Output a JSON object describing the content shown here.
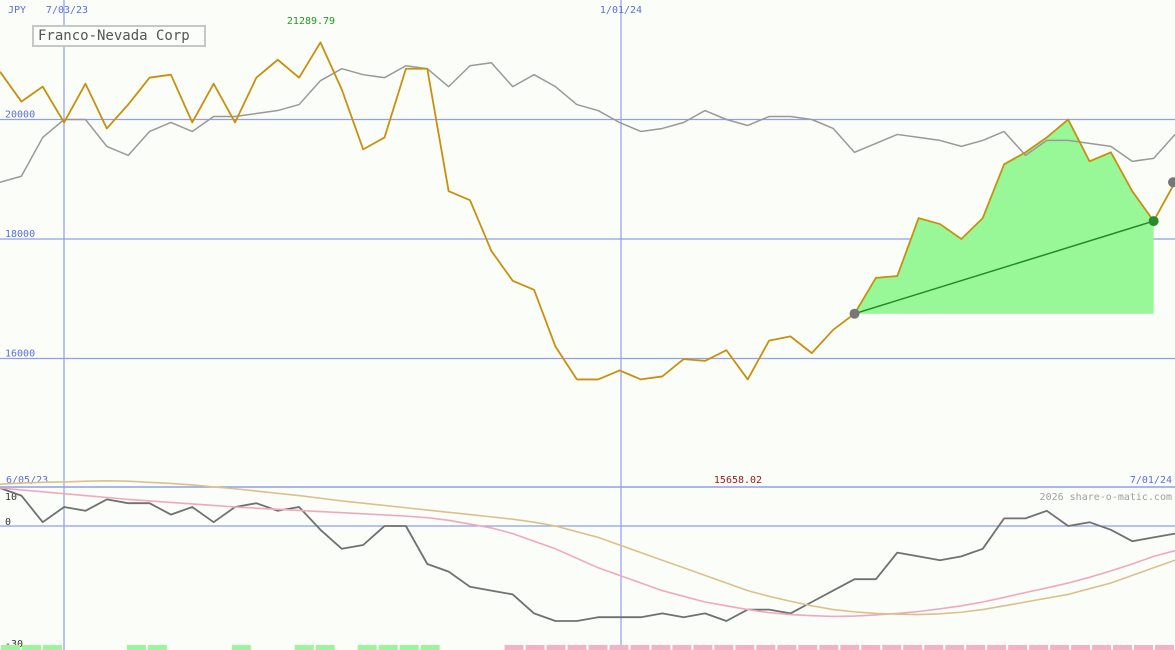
{
  "chart_data": [
    {
      "type": "line",
      "title": "Franco-Nevada Corp",
      "currency_label": "JPY",
      "x": [
        "7/03/23",
        "1/01/24"
      ],
      "ylabel": "",
      "xlabel": "",
      "ylim": [
        14000,
        22000
      ],
      "y_ticks": [
        "20000",
        "18000",
        "16000"
      ],
      "x_ticks": [
        "7/03/23",
        "1/01/24"
      ],
      "high_label": "21289.79",
      "series": [
        {
          "values": [
            20800,
            20300,
            20550,
            19950,
            20600,
            19850,
            20250,
            20700,
            20750,
            19950,
            20600,
            19950,
            20700,
            21000,
            20700,
            21290,
            20500,
            19500,
            19700,
            20850,
            20850,
            18800,
            18650,
            17800,
            17300,
            17150,
            16200,
            15650,
            15650,
            15800,
            15650,
            15700,
            15990,
            15960,
            16140,
            15650,
            16300,
            16370,
            16090,
            16480,
            16750,
            17350,
            17380,
            18350,
            18250,
            18000,
            18350,
            19250,
            19450,
            19700,
            20000,
            19300,
            19450,
            18800,
            18300,
            18950
          ],
          "color": "#c8900f"
        },
        {
          "values": [
            18950,
            19050,
            19700,
            20000,
            20000,
            19550,
            19400,
            19800,
            19950,
            19800,
            20050,
            20050,
            20100,
            20150,
            20250,
            20650,
            20850,
            20750,
            20700,
            20900,
            20850,
            20550,
            20900,
            20950,
            20550,
            20750,
            20550,
            20250,
            20150,
            19950,
            19800,
            19850,
            19950,
            20150,
            20000,
            19900,
            20050,
            20050,
            20000,
            19850,
            19450,
            19600,
            19750,
            19700,
            19650,
            19550,
            19650,
            19800,
            19400,
            19650,
            19650,
            19600,
            19550,
            19300,
            19350,
            19750
          ],
          "color": "#999999"
        }
      ],
      "trend": {
        "start_index": 40,
        "end_index": 54,
        "start_value": 16750,
        "end_value": 18300,
        "fill_color": "#98f898",
        "line_color": "#228b22"
      }
    },
    {
      "type": "line",
      "title": "",
      "x": [
        "6/05/23",
        "7/01/24"
      ],
      "ylim": [
        -30,
        12
      ],
      "y_ticks": [
        "10",
        "0",
        "-30"
      ],
      "mid_label": "15658.02",
      "watermark": "2026 share-o-matic.com",
      "series": [
        {
          "values": [
            10,
            8,
            1,
            5,
            4,
            7,
            6,
            6,
            3,
            5,
            1,
            5,
            6,
            4,
            5,
            -1,
            -6,
            -5,
            0,
            0,
            -10,
            -12,
            -16,
            -17,
            -18,
            -23,
            -25,
            -25,
            -24,
            -24,
            -24,
            -23,
            -24,
            -23,
            -25,
            -22,
            -22,
            -23,
            -20,
            -17,
            -14,
            -14,
            -7,
            -8,
            -9,
            -8,
            -6,
            2,
            2,
            4,
            0,
            1,
            -1,
            -4,
            -3,
            -2
          ],
          "color": "#707070"
        },
        {
          "values": [
            10,
            9.5,
            9,
            8.5,
            8,
            7.5,
            7,
            6.6,
            6.2,
            5.8,
            5.4,
            5,
            4.7,
            4.4,
            4.1,
            3.8,
            3.5,
            3.2,
            2.9,
            2.6,
            2.2,
            1.5,
            0.5,
            -0.5,
            -2,
            -4,
            -6,
            -8.5,
            -11,
            -13,
            -15,
            -17,
            -18.5,
            -20,
            -21,
            -22,
            -22.8,
            -23.3,
            -23.6,
            -23.8,
            -23.7,
            -23.4,
            -23,
            -22.5,
            -21.8,
            -21,
            -20,
            -18.8,
            -17.5,
            -16.3,
            -15,
            -13.5,
            -11.8,
            -10,
            -8,
            -6.5
          ],
          "color": "#f0a8c0"
        },
        {
          "values": [
            11,
            11.3,
            11.5,
            11.6,
            11.8,
            11.9,
            11.8,
            11.5,
            11.2,
            10.8,
            10.3,
            9.8,
            9.2,
            8.6,
            8,
            7.3,
            6.6,
            6,
            5.4,
            4.8,
            4.2,
            3.6,
            3,
            2.4,
            1.8,
            1,
            0,
            -1.5,
            -3,
            -5,
            -7,
            -9,
            -11,
            -13,
            -15,
            -17,
            -18.5,
            -19.8,
            -21,
            -22,
            -22.6,
            -23,
            -23.2,
            -23.3,
            -23.1,
            -22.7,
            -22,
            -21,
            -20,
            -19,
            -18,
            -16.5,
            -15,
            -13,
            -11,
            -9
          ],
          "color": "#dcc08c"
        }
      ],
      "histogram": [
        {
          "values": [
            1,
            1,
            1,
            0,
            0,
            0,
            1,
            1,
            0,
            0,
            0,
            1,
            0,
            0,
            1,
            1,
            0,
            1,
            1,
            1,
            1,
            0,
            0,
            0,
            -1,
            -1,
            -1,
            -1,
            -1,
            -1,
            -1,
            -1,
            -1,
            -1,
            -1,
            -1,
            -1,
            -1,
            -1,
            -1,
            -1,
            -1,
            -1,
            -1,
            -1,
            -1,
            -1,
            -1,
            -1,
            -1,
            -1,
            -1,
            -1,
            -1,
            -1,
            -1
          ]
        }
      ]
    }
  ],
  "colors": {
    "grid": "#8f9fe8",
    "axis_text": "#5a6fe0",
    "high_text": "#1f9a1f",
    "mid_text": "#9a1a1a",
    "watermark": "#a0a0a0",
    "positive_bar": "#98f898",
    "negative_bar": "#f8b0c8"
  }
}
